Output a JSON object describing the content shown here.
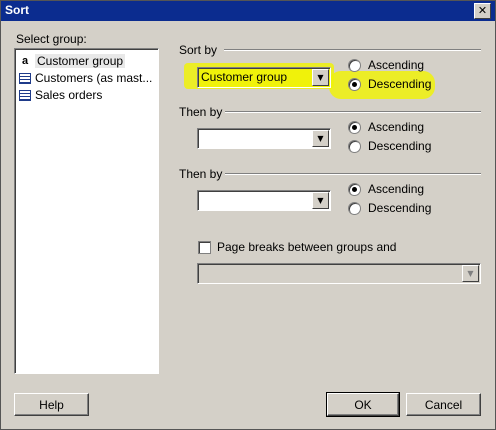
{
  "window": {
    "title": "Sort",
    "close_glyph": "✕"
  },
  "left_panel": {
    "label": "Select group:",
    "items": [
      {
        "icon": "a",
        "label": "Customer group",
        "selected": true
      },
      {
        "icon": "table-icon",
        "label": "Customers (as mast..."
      },
      {
        "icon": "table-icon",
        "label": "Sales orders"
      }
    ]
  },
  "sort_by": {
    "label": "Sort by",
    "value": "Customer group",
    "ascending": "Ascending",
    "descending": "Descending",
    "selected": "Descending"
  },
  "then_by_1": {
    "label": "Then by",
    "value": "",
    "ascending": "Ascending",
    "descending": "Descending",
    "selected": "Ascending"
  },
  "then_by_2": {
    "label": "Then by",
    "value": "",
    "ascending": "Ascending",
    "descending": "Descending",
    "selected": "Ascending"
  },
  "page_breaks": {
    "label": "Page breaks between groups and",
    "checked": false,
    "value": ""
  },
  "buttons": {
    "help": "Help",
    "ok": "OK",
    "cancel": "Cancel"
  },
  "colors": {
    "titlebar": "#0b2c8f",
    "highlight": "#f0f20a",
    "face": "#d4d0c8"
  },
  "icons": {
    "dropdown_arrow": "▼"
  }
}
